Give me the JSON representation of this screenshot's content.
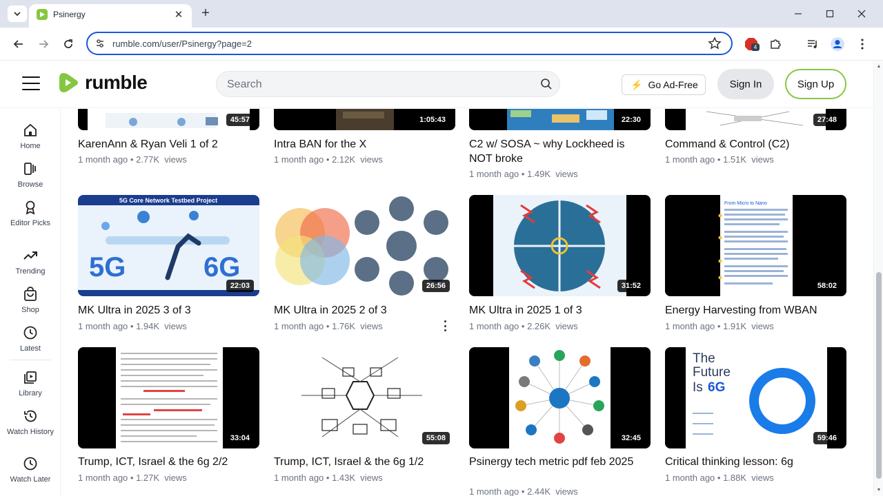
{
  "browser": {
    "tab_title": "Psinergy",
    "url": "rumble.com/user/Psinergy?page=2",
    "ext_badge": "4"
  },
  "header": {
    "logo_text": "rumble",
    "search_placeholder": "Search",
    "go_ad_free": "Go Ad-Free",
    "sign_in": "Sign In",
    "sign_up": "Sign Up"
  },
  "sidebar": {
    "items": [
      {
        "label": "Home",
        "icon": "home-icon"
      },
      {
        "label": "Browse",
        "icon": "browse-icon"
      },
      {
        "label": "Editor Picks",
        "icon": "editor-picks-icon"
      },
      {
        "label": "Trending",
        "icon": "trending-icon"
      },
      {
        "label": "Shop",
        "icon": "shop-icon"
      },
      {
        "label": "Latest",
        "icon": "latest-icon"
      },
      {
        "label": "Library",
        "icon": "library-icon"
      },
      {
        "label": "Watch History",
        "icon": "watch-history-icon"
      },
      {
        "label": "Watch Later",
        "icon": "watch-later-icon"
      }
    ]
  },
  "videos": [
    {
      "title": "KarenAnn & Ryan Veli 1 of 2",
      "duration": "45:57",
      "age": "1 month ago",
      "views": "2.77K",
      "views_label": "views"
    },
    {
      "title": "Intra BAN for the X",
      "duration": "1:05:43",
      "age": "1 month ago",
      "views": "2.12K",
      "views_label": "views"
    },
    {
      "title": "C2 w/ SOSA ~ why Lockheed is NOT broke",
      "duration": "22:30",
      "age": "1 month ago",
      "views": "1.49K",
      "views_label": "views"
    },
    {
      "title": "Command & Control (C2)",
      "duration": "27:48",
      "age": "1 month ago",
      "views": "1.51K",
      "views_label": "views"
    },
    {
      "title": "MK Ultra in 2025 3 of 3",
      "duration": "22:03",
      "age": "1 month ago",
      "views": "1.94K",
      "views_label": "views"
    },
    {
      "title": "MK Ultra in 2025 2 of 3",
      "duration": "26:56",
      "age": "1 month ago",
      "views": "1.76K",
      "views_label": "views"
    },
    {
      "title": "MK Ultra in 2025 1 of 3",
      "duration": "31:52",
      "age": "1 month ago",
      "views": "2.26K",
      "views_label": "views"
    },
    {
      "title": "Energy Harvesting from WBAN",
      "duration": "58:02",
      "age": "1 month ago",
      "views": "1.91K",
      "views_label": "views"
    },
    {
      "title": "Trump, ICT, Israel & the 6g 2/2",
      "duration": "33:04",
      "age": "1 month ago",
      "views": "1.27K",
      "views_label": "views"
    },
    {
      "title": "Trump, ICT, Israel & the 6g 1/2",
      "duration": "55:08",
      "age": "1 month ago",
      "views": "1.43K",
      "views_label": "views"
    },
    {
      "title": "Psinergy tech metric pdf feb 2025",
      "duration": "32:45",
      "age": "1 month ago",
      "views": "2.44K",
      "views_label": "views"
    },
    {
      "title": "Critical thinking lesson: 6g",
      "duration": "59:46",
      "age": "1 month ago",
      "views": "1.88K",
      "views_label": "views"
    }
  ],
  "thumb_text": {
    "fiveg_banner": "5G Core Network Testbed Project",
    "fiveg_left": "5G",
    "fiveg_right": "6G",
    "sixg_line1": "The",
    "sixg_line2": "Future",
    "sixg_line3": "Is",
    "sixg_bold": "6G",
    "wban_heading": "From Micro to Nano"
  },
  "colors": {
    "brand_green": "#85c742",
    "omnibox_blue": "#1a56db"
  }
}
